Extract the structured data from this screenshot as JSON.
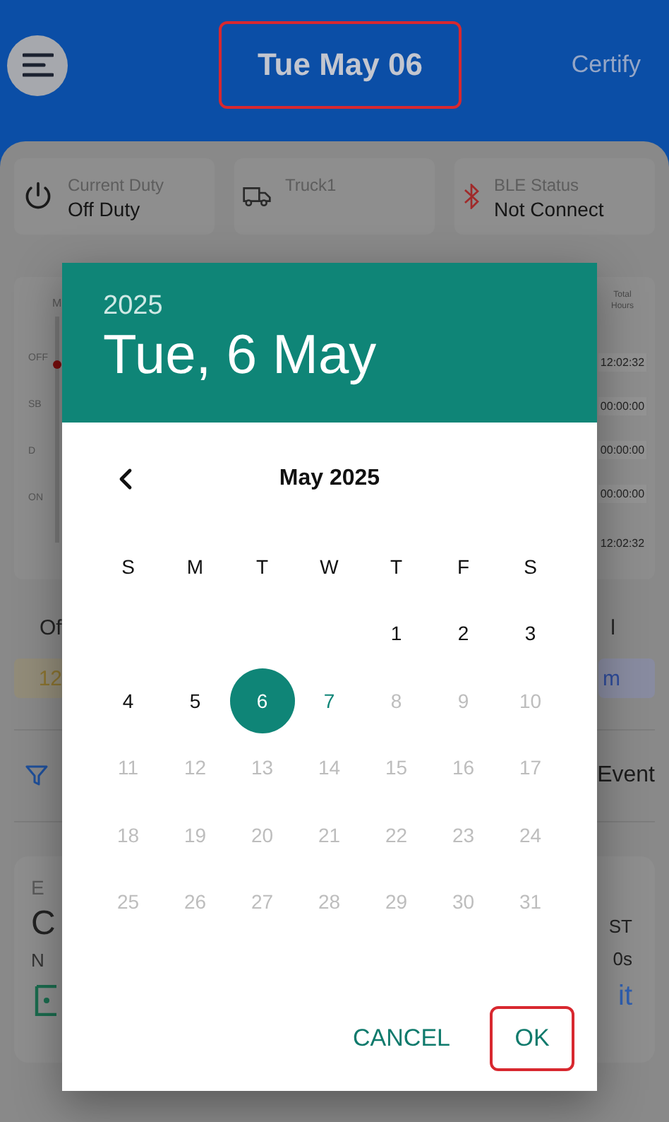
{
  "header": {
    "title": {
      "text": "Tue May 06",
      "highlighted": true
    },
    "action": "Certify"
  },
  "status_cards": [
    {
      "kind": "duty",
      "label": "Current Duty",
      "value": "Off Duty"
    },
    {
      "kind": "truck",
      "label": "Truck1"
    },
    {
      "kind": "bluetooth",
      "label": "BLE Status",
      "value": "Not Connect"
    }
  ],
  "log_chart": {
    "column_1_header": "M",
    "row_labels": [
      "OFF",
      "SB",
      "D",
      "ON"
    ],
    "totals_header": "Total Hours",
    "totals": [
      "12:02:32",
      "00:00:00",
      "00:00:00",
      "00:00:00"
    ],
    "grand_total": "12:02:32"
  },
  "summary": {
    "left_label": "Of",
    "right_label": "l",
    "left_chip": "12",
    "right_chip": "m"
  },
  "filter_row": {
    "right_text": "Event"
  },
  "event_card": {
    "line_1": "E",
    "line_2": "C",
    "line_3": "N",
    "right_1": "ST",
    "right_2": "0s",
    "right_3": "it"
  },
  "date_picker": {
    "year": "2025",
    "selected_date": "Tue, 6 May",
    "month_label": "May 2025",
    "weekdays": [
      "S",
      "M",
      "T",
      "W",
      "T",
      "F",
      "S"
    ],
    "weeks": [
      [
        {
          "day": "1",
          "selected": false,
          "disabled": false,
          "today": false
        },
        {
          "day": "2",
          "selected": false,
          "disabled": false,
          "today": false
        },
        {
          "day": "3",
          "selected": false,
          "disabled": false,
          "today": false
        }
      ],
      [
        {
          "day": "4",
          "selected": false,
          "disabled": false,
          "today": false
        },
        {
          "day": "5",
          "selected": false,
          "disabled": false,
          "today": false
        },
        {
          "day": "6",
          "selected": true,
          "disabled": false,
          "today": false
        },
        {
          "day": "7",
          "selected": false,
          "disabled": false,
          "today": true
        },
        {
          "day": "8",
          "selected": false,
          "disabled": true,
          "today": false
        },
        {
          "day": "9",
          "selected": false,
          "disabled": true,
          "today": false
        },
        {
          "day": "10",
          "selected": false,
          "disabled": true,
          "today": false
        }
      ],
      [
        {
          "day": "11",
          "selected": false,
          "disabled": true,
          "today": false
        },
        {
          "day": "12",
          "selected": false,
          "disabled": true,
          "today": false
        },
        {
          "day": "13",
          "selected": false,
          "disabled": true,
          "today": false
        },
        {
          "day": "14",
          "selected": false,
          "disabled": true,
          "today": false
        },
        {
          "day": "15",
          "selected": false,
          "disabled": true,
          "today": false
        },
        {
          "day": "16",
          "selected": false,
          "disabled": true,
          "today": false
        },
        {
          "day": "17",
          "selected": false,
          "disabled": true,
          "today": false
        }
      ],
      [
        {
          "day": "18",
          "selected": false,
          "disabled": true,
          "today": false
        },
        {
          "day": "19",
          "selected": false,
          "disabled": true,
          "today": false
        },
        {
          "day": "20",
          "selected": false,
          "disabled": true,
          "today": false
        },
        {
          "day": "21",
          "selected": false,
          "disabled": true,
          "today": false
        },
        {
          "day": "22",
          "selected": false,
          "disabled": true,
          "today": false
        },
        {
          "day": "23",
          "selected": false,
          "disabled": true,
          "today": false
        },
        {
          "day": "24",
          "selected": false,
          "disabled": true,
          "today": false
        }
      ],
      [
        {
          "day": "25",
          "selected": false,
          "disabled": true,
          "today": false
        },
        {
          "day": "26",
          "selected": false,
          "disabled": true,
          "today": false
        },
        {
          "day": "27",
          "selected": false,
          "disabled": true,
          "today": false
        },
        {
          "day": "28",
          "selected": false,
          "disabled": true,
          "today": false
        },
        {
          "day": "29",
          "selected": false,
          "disabled": true,
          "today": false
        },
        {
          "day": "30",
          "selected": false,
          "disabled": true,
          "today": false
        },
        {
          "day": "31",
          "selected": false,
          "disabled": true,
          "today": false
        }
      ]
    ],
    "buttons": [
      {
        "label": "CANCEL",
        "highlighted": false
      },
      {
        "label": "OK",
        "highlighted": true
      }
    ]
  }
}
